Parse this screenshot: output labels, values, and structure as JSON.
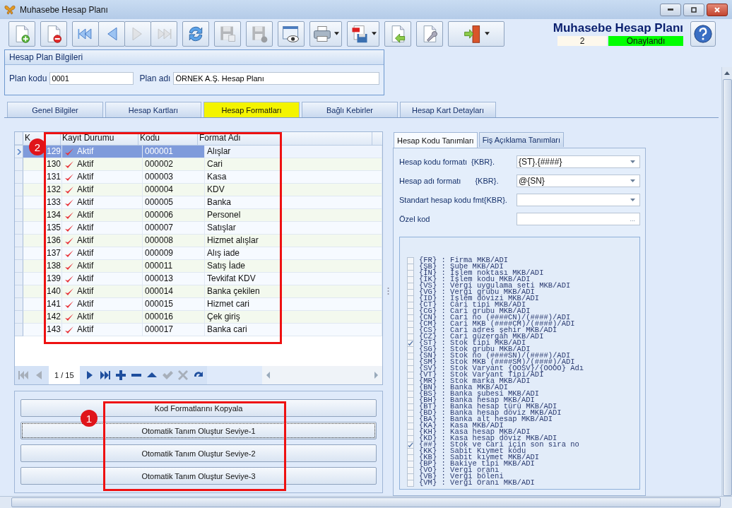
{
  "window": {
    "title": "Muhasebe Hesap Planı"
  },
  "toolbar": [
    {
      "kind": "new",
      "disabled": false
    },
    {
      "kind": "delete",
      "disabled": false
    },
    {
      "kind": "first",
      "disabled": false
    },
    {
      "kind": "prev",
      "disabled": false
    },
    {
      "kind": "next",
      "disabled": true
    },
    {
      "kind": "last",
      "disabled": true
    },
    {
      "kind": "refresh",
      "disabled": false
    },
    {
      "kind": "save",
      "disabled": true
    },
    {
      "kind": "cancel",
      "disabled": true
    },
    {
      "kind": "preview",
      "disabled": false
    },
    {
      "kind": "print",
      "disabled": false
    },
    {
      "kind": "pdf",
      "disabled": false
    },
    {
      "kind": "import",
      "disabled": false
    },
    {
      "kind": "tools",
      "disabled": false
    },
    {
      "kind": "exit",
      "disabled": false
    }
  ],
  "header": {
    "title": "Muhasebe Hesap Planı",
    "number": "2",
    "status": "Onaylandı"
  },
  "plan_group": {
    "title": "Hesap Plan Bilgileri",
    "code_label": "Plan kodu",
    "code": "0001",
    "name_label": "Plan adı",
    "name": "ÖRNEK A.Ş. Hesap Planı"
  },
  "tabs": [
    {
      "label": "Genel Bilgiler",
      "selected": false
    },
    {
      "label": "Hesap Kartları",
      "selected": false
    },
    {
      "label": "Hesap Formatları",
      "selected": true
    },
    {
      "label": "Bağlı Kebirler",
      "selected": false
    },
    {
      "label": "Hesap Kart Detayları",
      "selected": false
    }
  ],
  "grid": {
    "columns": [
      "K",
      "Kayıt Durumu",
      "Kodu",
      "Format Adı"
    ],
    "rows": [
      {
        "no": "129",
        "status": "Aktif",
        "code": "000001",
        "name": "Alışlar",
        "selected": true
      },
      {
        "no": "130",
        "status": "Aktif",
        "code": "000002",
        "name": "Cari",
        "selected": false
      },
      {
        "no": "131",
        "status": "Aktif",
        "code": "000003",
        "name": "Kasa",
        "selected": false
      },
      {
        "no": "132",
        "status": "Aktif",
        "code": "000004",
        "name": "KDV",
        "selected": false
      },
      {
        "no": "133",
        "status": "Aktif",
        "code": "000005",
        "name": "Banka",
        "selected": false
      },
      {
        "no": "134",
        "status": "Aktif",
        "code": "000006",
        "name": "Personel",
        "selected": false
      },
      {
        "no": "135",
        "status": "Aktif",
        "code": "000007",
        "name": "Satışlar",
        "selected": false
      },
      {
        "no": "136",
        "status": "Aktif",
        "code": "000008",
        "name": "Hizmet alışlar",
        "selected": false
      },
      {
        "no": "137",
        "status": "Aktif",
        "code": "000009",
        "name": "Alış iade",
        "selected": false
      },
      {
        "no": "138",
        "status": "Aktif",
        "code": "000011",
        "name": "Satış İade",
        "selected": false
      },
      {
        "no": "139",
        "status": "Aktif",
        "code": "000013",
        "name": "Tevkifat KDV",
        "selected": false
      },
      {
        "no": "140",
        "status": "Aktif",
        "code": "000014",
        "name": "Banka çekilen",
        "selected": false
      },
      {
        "no": "141",
        "status": "Aktif",
        "code": "000015",
        "name": "Hizmet cari",
        "selected": false
      },
      {
        "no": "142",
        "status": "Aktif",
        "code": "000016",
        "name": "Çek giriş",
        "selected": false
      },
      {
        "no": "143",
        "status": "Aktif",
        "code": "000017",
        "name": "Banka cari",
        "selected": false
      }
    ],
    "navigator": {
      "position": "1 / 15",
      "buttons": [
        {
          "kind": "first",
          "disabled": true
        },
        {
          "kind": "prev",
          "disabled": true
        },
        {
          "kind": "next",
          "disabled": false
        },
        {
          "kind": "last",
          "disabled": false
        },
        {
          "kind": "add",
          "disabled": false
        },
        {
          "kind": "remove",
          "disabled": false
        },
        {
          "kind": "up",
          "disabled": false
        },
        {
          "kind": "apply",
          "disabled": true
        },
        {
          "kind": "cancel",
          "disabled": true
        },
        {
          "kind": "redo",
          "disabled": false
        }
      ]
    }
  },
  "actions": [
    {
      "label": "Kod Formatlarını Kopyala",
      "focused": false
    },
    {
      "label": "Otomatik Tanım Oluştur Seviye-1",
      "focused": true
    },
    {
      "label": "Otomatik Tanım Oluştur Seviye-2",
      "focused": false
    },
    {
      "label": "Otomatik Tanım Oluştur Seviye-3",
      "focused": false
    }
  ],
  "annotations": [
    "1",
    "2"
  ],
  "sub_tabs": [
    {
      "label": "Hesap Kodu Tanımları",
      "selected": true
    },
    {
      "label": "Fiş Açıklama Tanımları",
      "selected": false
    }
  ],
  "fields": [
    {
      "kind": "combo",
      "label": "Hesap kodu formatı",
      "suffix": "{KBR}.",
      "value": "{ST}.{####}"
    },
    {
      "kind": "combo",
      "label": "Hesap adı formatı",
      "suffix": "{KBR}.",
      "value": "@{SN}"
    },
    {
      "kind": "combo",
      "label": "Standart hesap kodu fmt{KBR}."
    },
    {
      "kind": "ellipsis",
      "label": "Özel kod",
      "button": "..."
    }
  ],
  "tokens": [
    {
      "text": "{FR} : Firma MKB/ADI",
      "checked": false
    },
    {
      "text": "{ŞB} : Şube MKB/ADI",
      "checked": false
    },
    {
      "text": "{İN} : İşlem noktası MKB/ADI",
      "checked": false
    },
    {
      "text": "{İK} : İşlem kodu MKB/ADI",
      "checked": false
    },
    {
      "text": "{VS} : Vergi uygulama seti MKB/ADI",
      "checked": false
    },
    {
      "text": "{VG} : Vergi grubu MKB/ADI",
      "checked": false
    },
    {
      "text": "{ID} : İşlem dövizi MKB/ADI",
      "checked": false
    },
    {
      "text": "{CT} : Cari tipi MKB/ADI",
      "checked": false
    },
    {
      "text": "{CG} : Cari grubu MKB/ADI",
      "checked": false
    },
    {
      "text": "{CN} : Cari no (####CN)/(####)/ADI",
      "checked": false
    },
    {
      "text": "{CM} : Cari MKB (####CM)/(####)/ADI",
      "checked": false
    },
    {
      "text": "{CS} : Cari adres şehir MKB/ADI",
      "checked": false
    },
    {
      "text": "{CZ} : Cari güzergah MKB/ADI",
      "checked": false
    },
    {
      "text": "{ST} : Stok tipi MKB/ADI",
      "checked": true
    },
    {
      "text": "{SG} : Stok grubu MKB/ADI",
      "checked": false
    },
    {
      "text": "{SN} : Stok no (####SN)/(####)/ADI",
      "checked": false
    },
    {
      "text": "{SM} : Stok MKB (####SM)/(####)/ADI",
      "checked": false
    },
    {
      "text": "{SV} : Stok Varyant {OOSV}/{OOOO} Adı",
      "checked": false
    },
    {
      "text": "{VT} : Stok Varyant Tipi/ADI",
      "checked": false
    },
    {
      "text": "{MR} : Stok marka MKB/ADI",
      "checked": false
    },
    {
      "text": "{BN} : Banka MKB/ADI",
      "checked": false
    },
    {
      "text": "{BS} : Banka şubesi MKB/ADI",
      "checked": false
    },
    {
      "text": "{BH} : Banka hesap MKB/ADI",
      "checked": false
    },
    {
      "text": "{BT} : Banka hesap türü MKB/ADI",
      "checked": false
    },
    {
      "text": "{BD} : Banka hesap döviz MKB/ADI",
      "checked": false
    },
    {
      "text": "{BA} : Banka alt hesap MKB/ADI",
      "checked": false
    },
    {
      "text": "{KA} : Kasa MKB/ADI",
      "checked": false
    },
    {
      "text": "{KH} : Kasa hesap MKB/ADI",
      "checked": false
    },
    {
      "text": "{KD} : Kasa hesap döviz MKB/ADI",
      "checked": false
    },
    {
      "text": "{##} : Stok ve Cari için son sıra no",
      "checked": true
    },
    {
      "text": "{KK} : Sabit Kıymet kodu",
      "checked": false
    },
    {
      "text": "{KB} : Sabit kıymet MKB/ADI",
      "checked": false
    },
    {
      "text": "{BP} : Bakiye tipi MKB/ADI",
      "checked": false
    },
    {
      "text": "{VO} : Vergi oranı",
      "checked": false
    },
    {
      "text": "{VB} : Vergi böleni",
      "checked": false
    },
    {
      "text": "{VM} : Vergi Oranı MKB/ADI",
      "checked": false
    }
  ]
}
